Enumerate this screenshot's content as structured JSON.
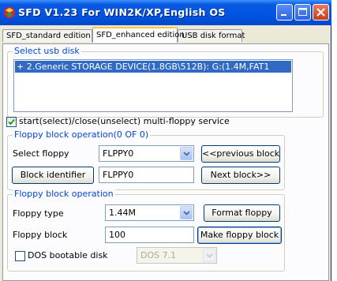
{
  "window": {
    "title": "SFD V1.23 For WIN2K/XP,English OS"
  },
  "tabs": [
    {
      "label": "SFD_standard edition"
    },
    {
      "label": "SFD_enhanced edition"
    },
    {
      "label": "USB disk format"
    }
  ],
  "usb_group": {
    "label": "Select usb disk",
    "items": [
      "+ 2.Generic STORAGE DEVICE(1.8GB\\512B): G:(1.4M,FAT1"
    ]
  },
  "multi_floppy": {
    "label": "start(select)/close(unselect) multi-floppy service",
    "checked": true
  },
  "block_group": {
    "label": "Floppy block operation(0 OF 0)",
    "select_floppy_label": "Select floppy",
    "select_floppy_value": "FLPPY0",
    "prev_button": "<<previous block",
    "block_identifier_button": "Block identifier",
    "block_identifier_value": "FLPPY0",
    "next_button": "Next block>>"
  },
  "operation_group": {
    "label": "Floppy block operation",
    "floppy_type_label": "Floppy type",
    "floppy_type_value": "1.44M",
    "format_button": "Format floppy",
    "floppy_block_label": "Floppy block",
    "floppy_block_value": "100",
    "make_button": "Make floppy block",
    "dos_bootable_label": "DOS bootable disk",
    "dos_bootable_checked": false,
    "dos_version_value": "DOS 7.1"
  },
  "colors": {
    "title_bar": "#0054e3",
    "group_label": "#0046d5",
    "selection": "#316ac5"
  }
}
